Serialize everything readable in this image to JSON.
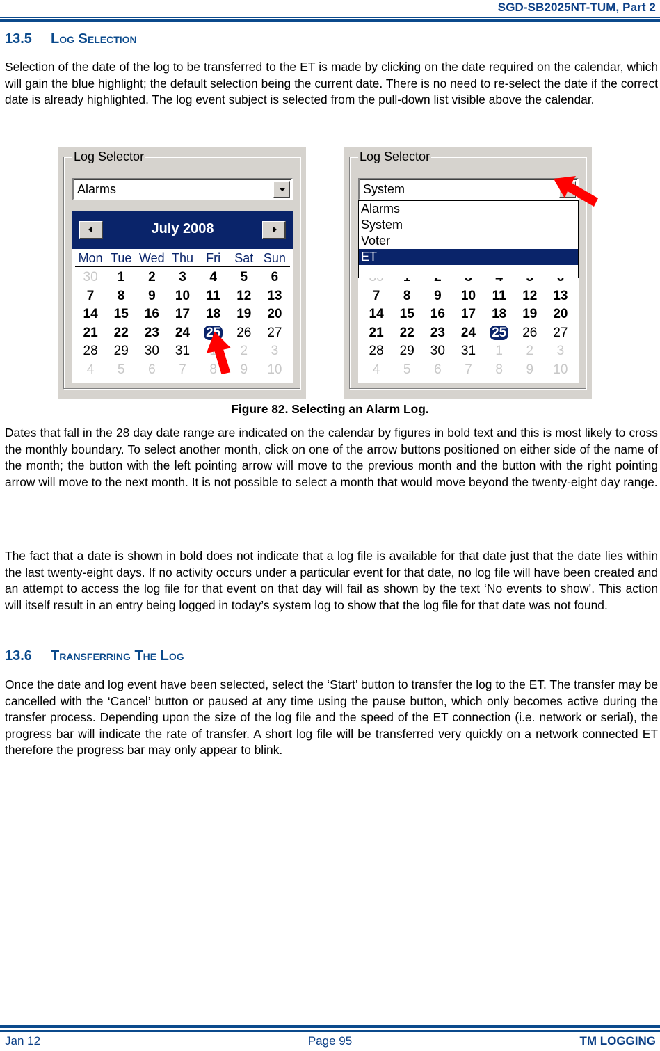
{
  "header": {
    "doc_title": "SGD-SB2025NT-TUM, Part 2"
  },
  "section_13_5": {
    "number": "13.5",
    "title": "Log Selection",
    "paragraph_1": "Selection of the date of the log to be transferred to the ET is made by clicking on the date required on the calendar, which will gain the blue highlight; the default selection being the current date.  There is no need to re-select the date if the correct date is already highlighted.  The log event subject is selected from the pull-down list visible above the calendar.",
    "paragraph_2": "Dates that fall in the 28 day date range are indicated on the calendar by figures in bold text and this is most likely to cross the monthly boundary.  To select another month, click on one of the arrow buttons positioned on either side of the name of the month; the button with the left pointing arrow will move to the previous month and the button with the right pointing arrow will move to the next month.  It is not possible to select a month that would move beyond the twenty-eight day range.",
    "paragraph_3": "The fact that a date is shown in bold does not indicate that a log file is available for that date just that the date lies within the last twenty-eight days.  If no activity occurs under a particular event for that date, no log file will have been created and an attempt to access the log file for that event on that day will fail as shown by the text ‘No events to show’.  This action will itself result in an entry being logged in today’s system log to show that the log file for that date was not found."
  },
  "figure": {
    "caption": "Figure 82.  Selecting an Alarm Log.",
    "left_panel": {
      "group_label": "Log Selector",
      "combo_value": "Alarms",
      "month_label": "July 2008",
      "prev_button_icon": "left-arrow-icon",
      "next_button_icon": "right-arrow-icon"
    },
    "right_panel": {
      "group_label": "Log Selector",
      "combo_value": "System",
      "dropdown_options": [
        "Alarms",
        "System",
        "Voter",
        "ET"
      ],
      "dropdown_highlighted": "ET"
    },
    "weekdays": [
      "Mon",
      "Tue",
      "Wed",
      "Thu",
      "Fri",
      "Sat",
      "Sun"
    ],
    "days": [
      {
        "d": "30",
        "s": "muted"
      },
      {
        "d": "1",
        "s": "bold"
      },
      {
        "d": "2",
        "s": "bold"
      },
      {
        "d": "3",
        "s": "bold"
      },
      {
        "d": "4",
        "s": "bold"
      },
      {
        "d": "5",
        "s": "bold"
      },
      {
        "d": "6",
        "s": "bold"
      },
      {
        "d": "7",
        "s": "bold"
      },
      {
        "d": "8",
        "s": "bold"
      },
      {
        "d": "9",
        "s": "bold"
      },
      {
        "d": "10",
        "s": "bold"
      },
      {
        "d": "11",
        "s": "bold"
      },
      {
        "d": "12",
        "s": "bold"
      },
      {
        "d": "13",
        "s": "bold"
      },
      {
        "d": "14",
        "s": "bold"
      },
      {
        "d": "15",
        "s": "bold"
      },
      {
        "d": "16",
        "s": "bold"
      },
      {
        "d": "17",
        "s": "bold"
      },
      {
        "d": "18",
        "s": "bold"
      },
      {
        "d": "19",
        "s": "bold"
      },
      {
        "d": "20",
        "s": "bold"
      },
      {
        "d": "21",
        "s": "bold"
      },
      {
        "d": "22",
        "s": "bold"
      },
      {
        "d": "23",
        "s": "bold"
      },
      {
        "d": "24",
        "s": "bold"
      },
      {
        "d": "25",
        "s": "selected"
      },
      {
        "d": "26",
        "s": "normal"
      },
      {
        "d": "27",
        "s": "normal"
      },
      {
        "d": "28",
        "s": "normal"
      },
      {
        "d": "29",
        "s": "normal"
      },
      {
        "d": "30",
        "s": "normal"
      },
      {
        "d": "31",
        "s": "normal"
      },
      {
        "d": "1",
        "s": "muted"
      },
      {
        "d": "2",
        "s": "muted"
      },
      {
        "d": "3",
        "s": "muted"
      },
      {
        "d": "4",
        "s": "muted"
      },
      {
        "d": "5",
        "s": "muted"
      },
      {
        "d": "6",
        "s": "muted"
      },
      {
        "d": "7",
        "s": "muted"
      },
      {
        "d": "8",
        "s": "muted"
      },
      {
        "d": "9",
        "s": "muted"
      },
      {
        "d": "10",
        "s": "muted"
      }
    ],
    "selected_date": "25",
    "colors": {
      "highlight": "#0a246a",
      "annotation_arrow": "#ff0000",
      "panel_bg": "#d6d3ce"
    }
  },
  "section_13_6": {
    "number": "13.6",
    "title": "Transferring The Log",
    "paragraph_1": "Once the date and log event have been selected, select the ‘Start’ button to transfer the log to the ET.  The transfer may be cancelled with the ‘Cancel’ button or paused at any time using the pause button, which only becomes active during the transfer process.  Depending upon the size of the log file and the speed of the ET connection (i.e. network or serial), the progress bar will indicate the rate of transfer.  A short log file will be transferred very quickly on a network connected ET therefore the progress bar may only appear to blink."
  },
  "footer": {
    "date": "Jan 12",
    "page": "Page 95",
    "chapter": "TM LOGGING"
  },
  "theme": {
    "brand_blue": "#0b4a8c"
  }
}
